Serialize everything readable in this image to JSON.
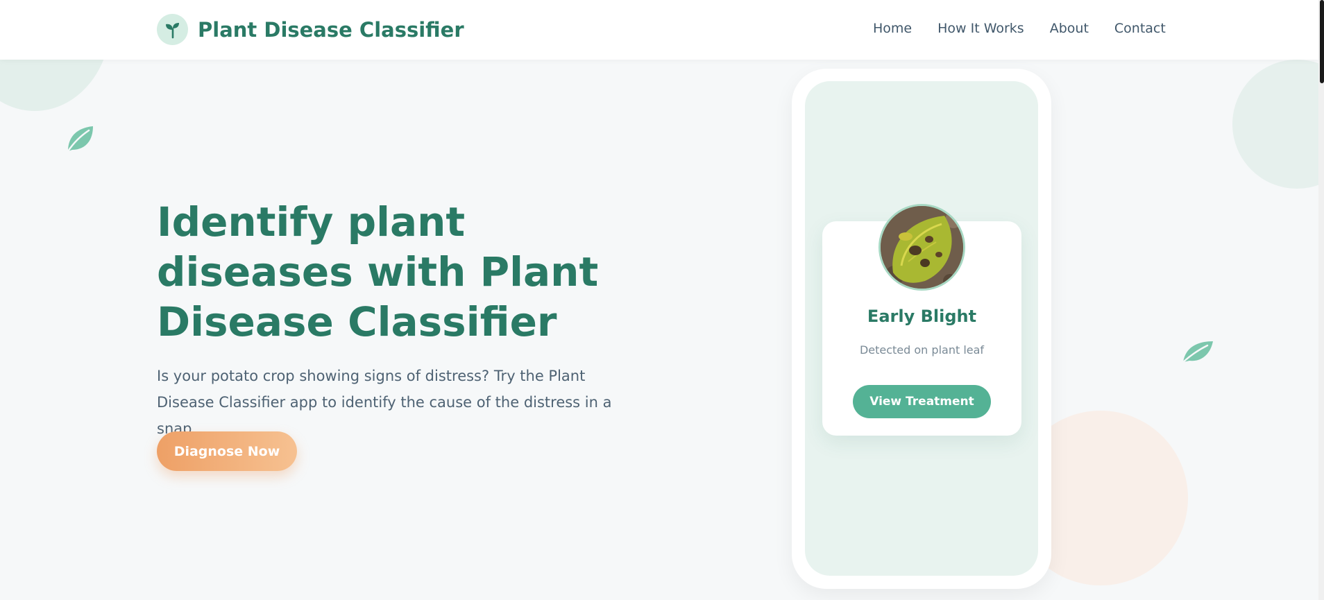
{
  "header": {
    "brand_name": "Plant Disease Classifier",
    "brand_icon": "sprout-icon",
    "nav": [
      {
        "label": "Home"
      },
      {
        "label": "How It Works"
      },
      {
        "label": "About"
      },
      {
        "label": "Contact"
      }
    ]
  },
  "hero": {
    "title": "Identify plant diseases with Plant Disease Classifier",
    "description": "Is your potato crop showing signs of distress? Try the Plant Disease Classifier app to identify the cause of the distress in a snap.",
    "cta_label": "Diagnose Now"
  },
  "result_card": {
    "title": "Early Blight",
    "subtitle": "Detected on plant leaf",
    "button_label": "View Treatment",
    "image_icon": "diseased-leaf-photo"
  },
  "colors": {
    "brand": "#2a7a65",
    "accent_green": "#54b295",
    "accent_orange": "#eea066",
    "background": "#f6f8f9"
  }
}
